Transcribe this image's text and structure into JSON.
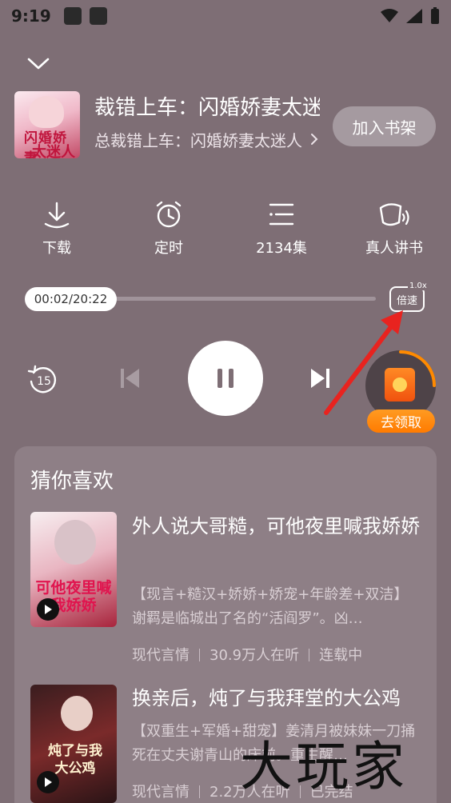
{
  "status_bar": {
    "time": "9:19"
  },
  "player": {
    "book_title": "裁错上车：闪婚娇妻太迷人",
    "book_subtitle": "总裁错上车：闪婚娇妻太迷人",
    "cover_line1": "闪婚娇妻",
    "cover_line2": "太迷人",
    "add_shelf_label": "加入书架",
    "actions": {
      "download": "下载",
      "timer": "定时",
      "episodes": "2134集",
      "voice": "真人讲书"
    },
    "time_display": "00:02/20:22",
    "progress_fraction": 0.002,
    "speed_label": "倍速",
    "speed_value": "1.0x",
    "rewind_seconds": "15",
    "reward_label": "去领取"
  },
  "recommend": {
    "title": "猜你喜欢",
    "items": [
      {
        "name": "外人说大哥糙，可他夜里喊我娇娇",
        "desc": "【现言+糙汉+娇娇+娇宠+年龄差+双洁】谢羁是临城出了名的“活阎罗”。凶…",
        "genre": "现代言情",
        "listeners": "30.9万人在听",
        "status": "连载中",
        "cover_text": "可他夜里喊我娇娇"
      },
      {
        "name": "换亲后，炖了与我拜堂的大公鸡",
        "desc": "【双重生+军婚+甜宠】姜清月被妹妹一刀捅死在丈夫谢青山的床前。重生醒…",
        "genre": "现代言情",
        "listeners": "2.2万人在听",
        "status": "已完结",
        "cover_text": "炖了与我大公鸡"
      }
    ]
  },
  "watermark": "大玩家",
  "colors": {
    "background": "#7e6e75",
    "panel": "#8e7f86",
    "accent_orange": "#ff8a00",
    "arrow_red": "#e8231f"
  }
}
